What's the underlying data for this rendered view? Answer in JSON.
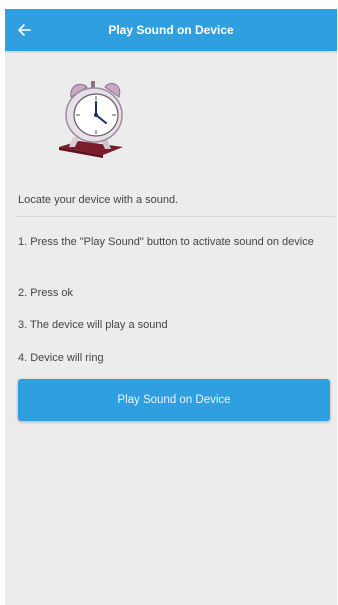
{
  "header": {
    "title": "Play Sound on Device",
    "back_icon": "arrow-left-icon"
  },
  "illustration": {
    "icon": "alarm-clock-icon"
  },
  "intro_text": "Locate your device with a sound.",
  "steps": [
    "1. Press the \"Play Sound\" button to activate sound on device",
    "2. Press ok",
    "3. The device will play a sound",
    "4. Device will ring"
  ],
  "action_button": {
    "label": "Play Sound on Device"
  },
  "colors": {
    "app_bar": "#2f9fe0",
    "button": "#2f9fe0",
    "background": "#ececec",
    "text": "#444444"
  }
}
